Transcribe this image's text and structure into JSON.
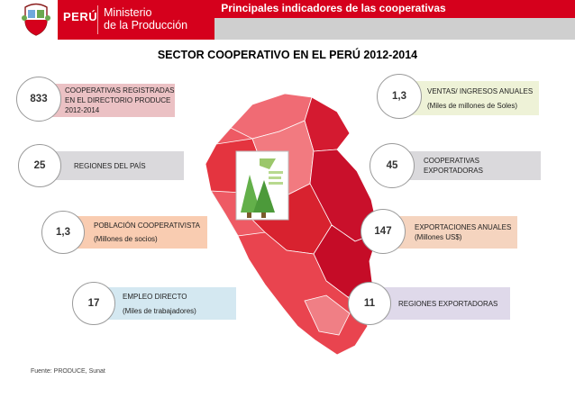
{
  "header": {
    "country": "PERÚ",
    "ministry_line1": "Ministerio",
    "ministry_line2": "de la Producción",
    "section_title": "Principales indicadores de las cooperativas"
  },
  "main_title": "SECTOR COOPERATIVO EN EL PERÚ 2012-2014",
  "indicators": [
    {
      "value": "833",
      "line1": "COOPERATIVAS REGISTRADAS",
      "line2": "EN EL DIRECTORIO PRODUCE",
      "line3": "2012-2014"
    },
    {
      "value": "25",
      "line1": "REGIONES DEL PAÍS"
    },
    {
      "value": "1,3",
      "line1": "POBLACIÓN COOPERATIVISTA",
      "line2": "(Millones de socios)"
    },
    {
      "value": "17",
      "line1": "EMPLEO DIRECTO",
      "line2": "(Miles de trabajadores)"
    },
    {
      "value": "1,3",
      "line1": "VENTAS/ INGRESOS ANUALES",
      "line2": "(Miles de millones de Soles)"
    },
    {
      "value": "45",
      "line1": "COOPERATIVAS EXPORTADORAS"
    },
    {
      "value": "147",
      "line1": "EXPORTACIONES ANUALES",
      "line2": "(Millones US$)"
    },
    {
      "value": "11",
      "line1": "REGIONES EXPORTADORAS"
    }
  ],
  "source": "Fuente: PRODUCE, Sunat",
  "colors": {
    "brand_red": "#d5001c",
    "map_dark_red": "#c9102b",
    "map_light_red": "#ee5a64"
  }
}
